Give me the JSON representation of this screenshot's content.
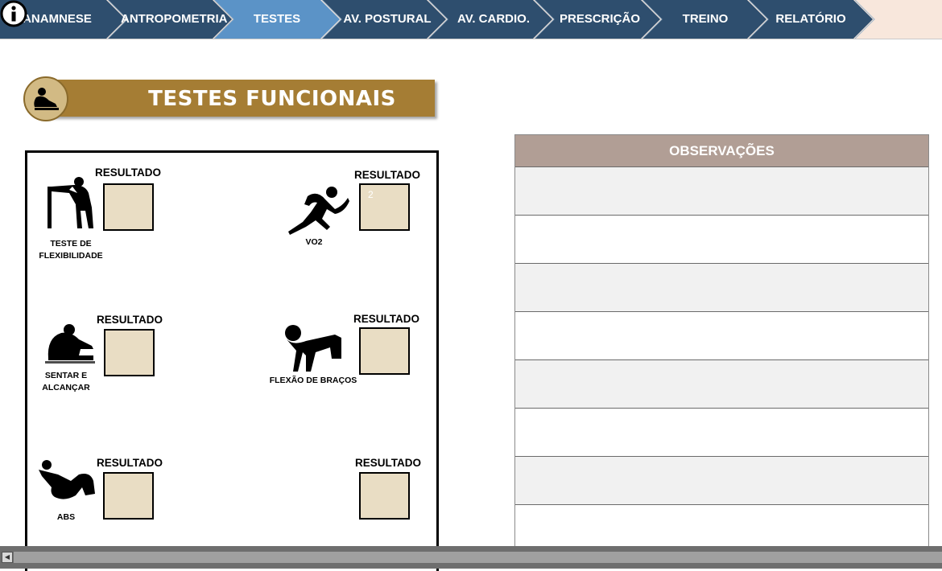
{
  "nav": {
    "tabs": [
      {
        "label": "ANAMNESE",
        "active": false
      },
      {
        "label": "ANTROPOMETRIA",
        "active": false
      },
      {
        "label": "TESTES",
        "active": true
      },
      {
        "label": "AV. POSTURAL",
        "active": false
      },
      {
        "label": "AV. CARDIO.",
        "active": false
      },
      {
        "label": "PRESCRIÇÃO",
        "active": false
      },
      {
        "label": "TREINO",
        "active": false
      },
      {
        "label": "RELATÓRIO",
        "active": false
      }
    ],
    "info_icon": "info-circle-icon",
    "colors": {
      "tab": "#2e4e6e",
      "active_tab": "#5b93c7",
      "background": "#f8e7dc"
    }
  },
  "section": {
    "title": "TESTES FUNCIONAIS",
    "icon": "stretch-person-icon",
    "color": "#a57d34"
  },
  "tests": [
    {
      "name_lines": [
        "TESTE DE",
        "FLEXIBILIDADE"
      ],
      "result_label": "RESULTADO",
      "value": "",
      "icon": "wall-stretch-icon"
    },
    {
      "name_lines": [
        "VO2"
      ],
      "result_label": "RESULTADO",
      "value": "2",
      "icon": "runner-icon"
    },
    {
      "name_lines": [
        "SENTAR E",
        "ALCANÇAR"
      ],
      "result_label": "RESULTADO",
      "value": "",
      "icon": "sit-and-reach-icon"
    },
    {
      "name_lines": [
        "FLEXÃO DE BRAÇOS"
      ],
      "result_label": "RESULTADO",
      "value": "",
      "icon": "push-up-icon"
    },
    {
      "name_lines": [
        "ABS"
      ],
      "result_label": "RESULTADO",
      "value": "",
      "icon": "sit-up-icon"
    },
    {
      "name_lines": [],
      "result_label": "RESULTADO",
      "value": "",
      "icon": ""
    }
  ],
  "observations": {
    "title": "OBSERVAÇÕES",
    "rows": [
      "",
      "",
      "",
      "",
      "",
      "",
      "",
      ""
    ],
    "header_color": "#b19e95"
  }
}
